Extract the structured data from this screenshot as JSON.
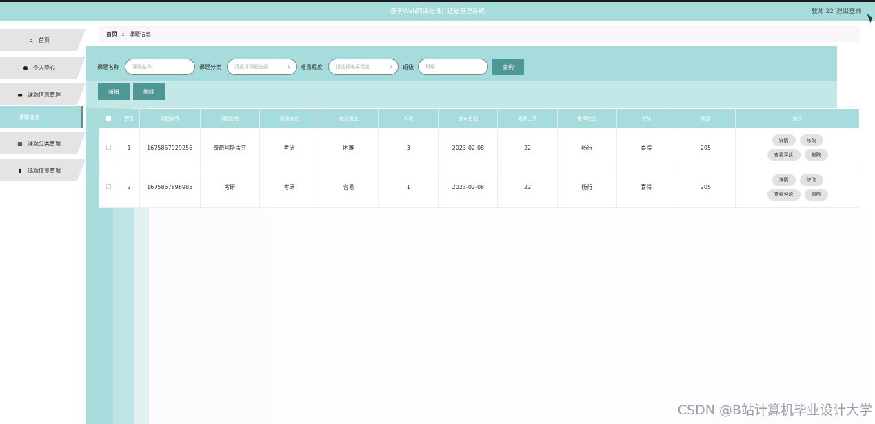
{
  "header": {
    "title": "基于Web的课程设计选题管理系统",
    "user": "教师 22",
    "logout": "退出登录"
  },
  "sidebar": {
    "items": [
      {
        "label": "首页",
        "icon": "home-icon"
      },
      {
        "label": "个人中心",
        "icon": "user-icon"
      },
      {
        "label": "课题信息管理",
        "icon": "briefcase-icon"
      },
      {
        "label": "课题信息",
        "icon": ""
      },
      {
        "label": "课题分类管理",
        "icon": "grid-icon"
      },
      {
        "label": "选题信息管理",
        "icon": "document-icon"
      }
    ]
  },
  "breadcrumb": {
    "home": "首页",
    "sep": "Ξ",
    "current": "课题信息"
  },
  "search": {
    "name_label": "课题名称",
    "name_placeholder": "课题名称",
    "category_label": "课题分类",
    "category_placeholder": "请选择课题分类",
    "difficulty_label": "难易程度",
    "difficulty_placeholder": "请选择难易程度",
    "class_label": "班级",
    "class_placeholder": "班级",
    "search_button": "查询"
  },
  "actions": {
    "add": "新增",
    "delete": "删除"
  },
  "table": {
    "columns": [
      "",
      "索引",
      "课题编号",
      "课题名称",
      "课题分类",
      "难易程度",
      "人数",
      "发布日期",
      "教师工号",
      "教师姓名",
      "学院",
      "班级",
      "操作"
    ],
    "rows": [
      {
        "index": "1",
        "code": "1675857929256",
        "name": "奇葩阿斯蒂芬",
        "category": "考研",
        "difficulty": "困难",
        "count": "3",
        "date": "2023-02-08",
        "teacher_id": "22",
        "teacher_name": "杨行",
        "college": "喜得",
        "class": "205"
      },
      {
        "index": "2",
        "code": "1675857896985",
        "name": "考研",
        "category": "考研",
        "difficulty": "容易",
        "count": "1",
        "date": "2023-02-08",
        "teacher_id": "22",
        "teacher_name": "杨行",
        "college": "喜得",
        "class": "205"
      }
    ],
    "ops": {
      "detail": "详情",
      "edit": "修改",
      "comments": "查看评论",
      "delete": "删除"
    }
  },
  "watermark": "CSDN @B站计算机毕业设计大学"
}
